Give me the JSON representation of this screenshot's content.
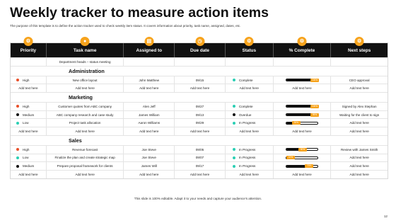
{
  "title": "Weekly tracker to measure action items",
  "subtitle": "The purpose of this template is to define the action tracker used to check weekly item status. It covers information about priority, task name, assigned, dates, etc.",
  "colors": {
    "high": "#e8502a",
    "medium": "#111111",
    "low": "#2bcfb4",
    "complete": "#2bcfb4",
    "overdue": "#111111",
    "in_progress": "#2bcfb4",
    "accent": "#f7a31c"
  },
  "headers": [
    {
      "label": "Priority",
      "icon": "gear-icon"
    },
    {
      "label": "Task name",
      "icon": "person-icon"
    },
    {
      "label": "Assigned to",
      "icon": "document-icon"
    },
    {
      "label": "Due date",
      "icon": "clock-icon"
    },
    {
      "label": "Status",
      "icon": "gear-icon"
    },
    {
      "label": "% Complete",
      "icon": "gear-icon"
    },
    {
      "label": "Next steps",
      "icon": "gear-icon"
    }
  ],
  "intro_row": {
    "task": "Department heads – status meeting"
  },
  "sections": [
    {
      "category": "Administration",
      "rows": [
        {
          "priority": "High",
          "priority_color": "#e8502a",
          "task": "New office layout",
          "assigned": "John Matthew",
          "due": "09/15",
          "status": "Complete",
          "status_color": "#2bcfb4",
          "percent": 1.0,
          "percent_label": "100%",
          "next": "CEO approval"
        },
        {
          "priority": "Add text here",
          "priority_color": "",
          "task": "Add text here",
          "assigned": "Add text here",
          "due": "Add text here",
          "status": "Add text here",
          "status_color": "",
          "percent": null,
          "percent_label": "",
          "next": "Add text here"
        }
      ]
    },
    {
      "category": "Marketing",
      "rows": [
        {
          "priority": "High",
          "priority_color": "#e8502a",
          "task": "Customer quotes from ABC company",
          "assigned": "Alen Jeff",
          "due": "09/27",
          "status": "Complete",
          "status_color": "#2bcfb4",
          "percent": 1.0,
          "percent_label": "100%",
          "next": "Signed by Alex Stephan"
        },
        {
          "priority": "Medium",
          "priority_color": "#111111",
          "task": "ABC company research and case study",
          "assigned": "James William",
          "due": "09/13",
          "status": "Overdue",
          "status_color": "#111111",
          "percent": 0.95,
          "percent_label": "95%",
          "next": "Waiting for the client to sign"
        },
        {
          "priority": "Low",
          "priority_color": "#2bcfb4",
          "task": "Project task allocation",
          "assigned": "Aaron Williams",
          "due": "09/29",
          "status": "In Progress",
          "status_color": "#2bcfb4",
          "percent": 0.3,
          "percent_label": "30%",
          "next": "Add text here"
        },
        {
          "priority": "Add text here",
          "priority_color": "",
          "task": "Add text here",
          "assigned": "Add text here",
          "due": "Add text here",
          "status": "Add text here",
          "status_color": "",
          "percent": null,
          "percent_label": "",
          "next": "Add text here"
        }
      ]
    },
    {
      "category": "Sales",
      "rows": [
        {
          "priority": "High",
          "priority_color": "#e8502a",
          "task": "Revenue forecast",
          "assigned": "Joe Steve",
          "due": "09/05",
          "status": "In Progress",
          "status_color": "#2bcfb4",
          "percent": 0.5,
          "percent_label": "50%",
          "next": "Review with James Smith"
        },
        {
          "priority": "Low",
          "priority_color": "#2bcfb4",
          "task": "Finalize the plan and create strategic map",
          "assigned": "Joe Steve",
          "due": "09/07",
          "status": "In Progress",
          "status_color": "#2bcfb4",
          "percent": 0.1,
          "percent_label": "10%",
          "next": "Add text here"
        },
        {
          "priority": "Medium",
          "priority_color": "#111111",
          "task": "Prepare proposal framework for clients",
          "assigned": "James Will",
          "due": "09/17",
          "status": "In Progress",
          "status_color": "#2bcfb4",
          "percent": 0.7,
          "percent_label": "70%",
          "next": "Add text here"
        },
        {
          "priority": "Add text here",
          "priority_color": "",
          "task": "Add text here",
          "assigned": "Add text here",
          "due": "Add text here",
          "status": "Add text here",
          "status_color": "",
          "percent": null,
          "percent_label": "",
          "next": "Add text here"
        }
      ]
    }
  ],
  "footer": "This slide is 100% editable. Adapt it to your needs and capture your audience's attention.",
  "page_number": "12"
}
